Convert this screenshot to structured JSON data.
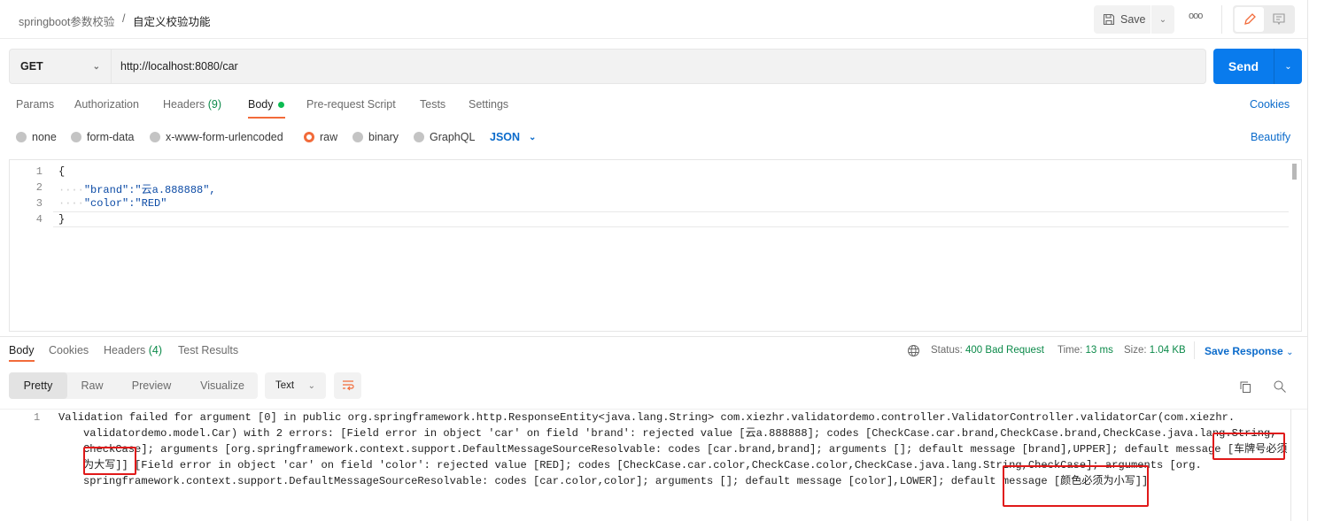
{
  "breadcrumb": {
    "collection": "springboot参数校验",
    "separator": "/",
    "request": "自定义校验功能"
  },
  "toolbar": {
    "save_label": "Save",
    "more_label": "ooo"
  },
  "request": {
    "method": "GET",
    "url": "http://localhost:8080/car",
    "send_label": "Send"
  },
  "tabs": [
    {
      "label": "Params"
    },
    {
      "label": "Authorization"
    },
    {
      "label": "Headers",
      "count": "(9)"
    },
    {
      "label": "Body"
    },
    {
      "label": "Pre-request Script"
    },
    {
      "label": "Tests"
    },
    {
      "label": "Settings"
    }
  ],
  "cookies_label": "Cookies",
  "body_types": [
    "none",
    "form-data",
    "x-www-form-urlencoded",
    "raw",
    "binary",
    "GraphQL"
  ],
  "body_selected": "raw",
  "body_format": "JSON",
  "beautify_label": "Beautify",
  "editor": {
    "lines": [
      "{",
      "\"brand\":\"云a.888888\",",
      "\"color\":\"RED\"",
      "}"
    ],
    "line_numbers": [
      "1",
      "2",
      "3",
      "4"
    ]
  },
  "response": {
    "tabs": [
      {
        "label": "Body"
      },
      {
        "label": "Cookies"
      },
      {
        "label": "Headers",
        "count": "(4)"
      },
      {
        "label": "Test Results"
      }
    ],
    "status_label": "Status:",
    "status": "400 Bad Request",
    "time_label": "Time:",
    "time": "13 ms",
    "size_label": "Size:",
    "size": "1.04 KB",
    "save_response": "Save Response",
    "views": [
      "Pretty",
      "Raw",
      "Preview",
      "Visualize"
    ],
    "format": "Text",
    "line_number": "1",
    "lines": [
      "Validation failed for argument [0] in public org.springframework.http.ResponseEntity<java.lang.String> com.xiezhr.validatordemo.controller.ValidatorController.validatorCar(com.xiezhr.",
      "validatordemo.model.Car) with 2 errors: [Field error in object 'car' on field 'brand': rejected value [云a.888888]; codes [CheckCase.car.brand,CheckCase.brand,CheckCase.java.lang.String,",
      "CheckCase]; arguments [org.springframework.context.support.DefaultMessageSourceResolvable: codes [car.brand,brand]; arguments []; default message [brand],UPPER]; default message [车牌号必须",
      "为大写]] [Field error in object 'car' on field 'color': rejected value [RED]; codes [CheckCase.car.color,CheckCase.color,CheckCase.java.lang.String,CheckCase]; arguments [org.",
      "springframework.context.support.DefaultMessageSourceResolvable: codes [car.color,color]; arguments []; default message [color],LOWER]; default message [颜色必须为小写]]"
    ]
  },
  "colors": {
    "accent": "#097bed",
    "orange": "#f26b3a",
    "status_green": "#0c8a4a",
    "highlight_box": "#e01919"
  }
}
